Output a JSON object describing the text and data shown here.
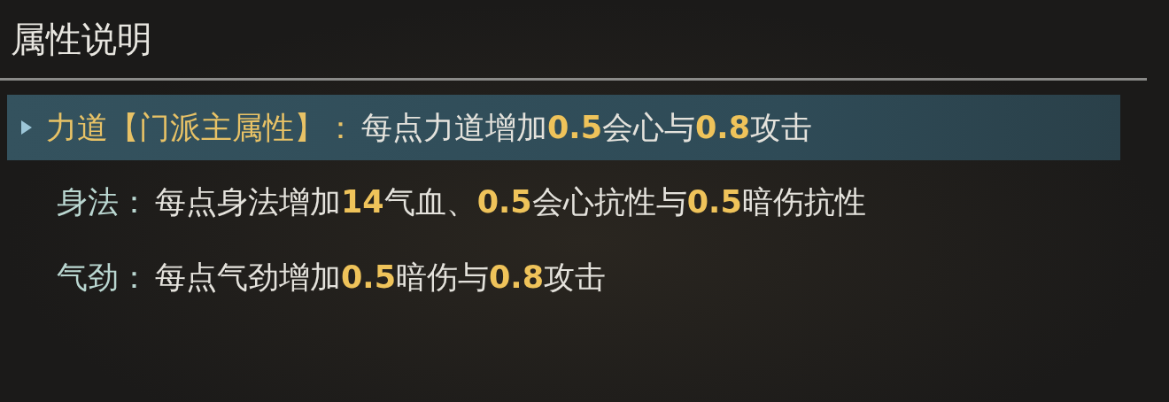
{
  "title": "属性说明",
  "attributes": [
    {
      "label": "力道【门派主属性】：",
      "description": "每点力道增加**0.5**会心与**0.8**攻击",
      "selected": true
    },
    {
      "label": "身法：",
      "description": "每点身法增加**14**气血、**0.5**会心抗性与**0.5**暗伤抗性",
      "selected": false
    },
    {
      "label": "气劲：",
      "description": "每点气劲增加**0.5**暗伤与**0.8**攻击",
      "selected": false
    }
  ]
}
